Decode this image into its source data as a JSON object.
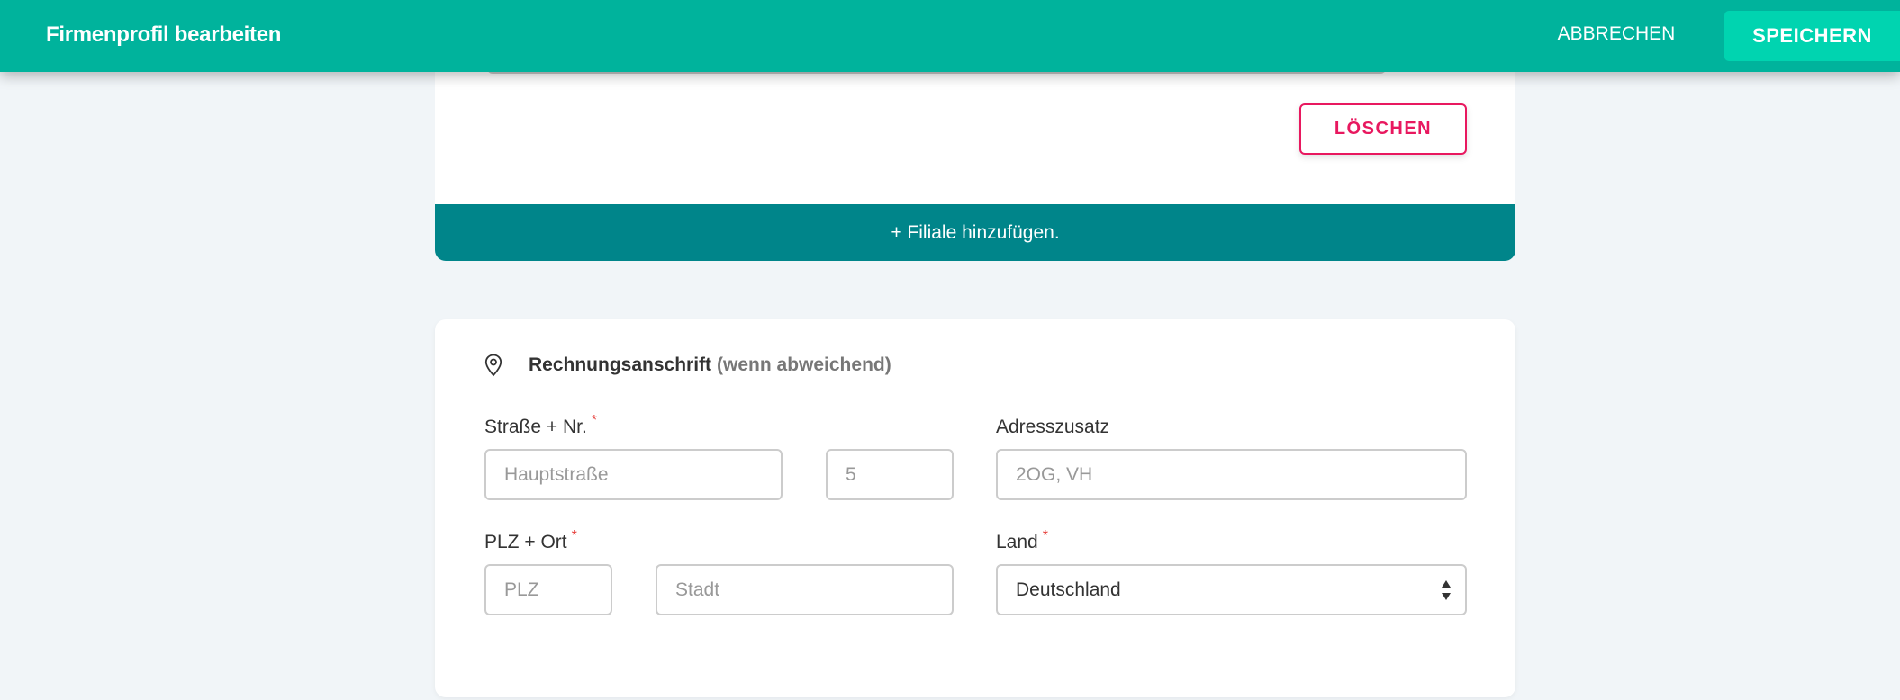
{
  "header": {
    "title": "Firmenprofil bearbeiten",
    "cancel_label": "ABBRECHEN",
    "save_label": "SPEICHERN"
  },
  "branch_card": {
    "delete_label": "LÖSCHEN",
    "add_branch_label": "+ Filiale hinzufügen."
  },
  "billing": {
    "title": "Rechnungsanschrift",
    "subtitle": "(wenn abweichend)",
    "icon": "location-pin-icon",
    "street_label": "Straße + Nr.",
    "required_mark": "*",
    "street_placeholder": "Hauptstraße",
    "number_placeholder": "5",
    "address_extra_label": "Adresszusatz",
    "address_extra_placeholder": "2OG, VH",
    "zip_city_label": "PLZ + Ort",
    "zip_placeholder": "PLZ",
    "city_placeholder": "Stadt",
    "country_label": "Land",
    "country_value": "Deutschland"
  },
  "colors": {
    "header": "#00b39c",
    "save_button": "#00d4b0",
    "add_branch": "#00858a",
    "delete": "#e8185f",
    "required": "#e53935",
    "background": "#f1f5f8"
  }
}
